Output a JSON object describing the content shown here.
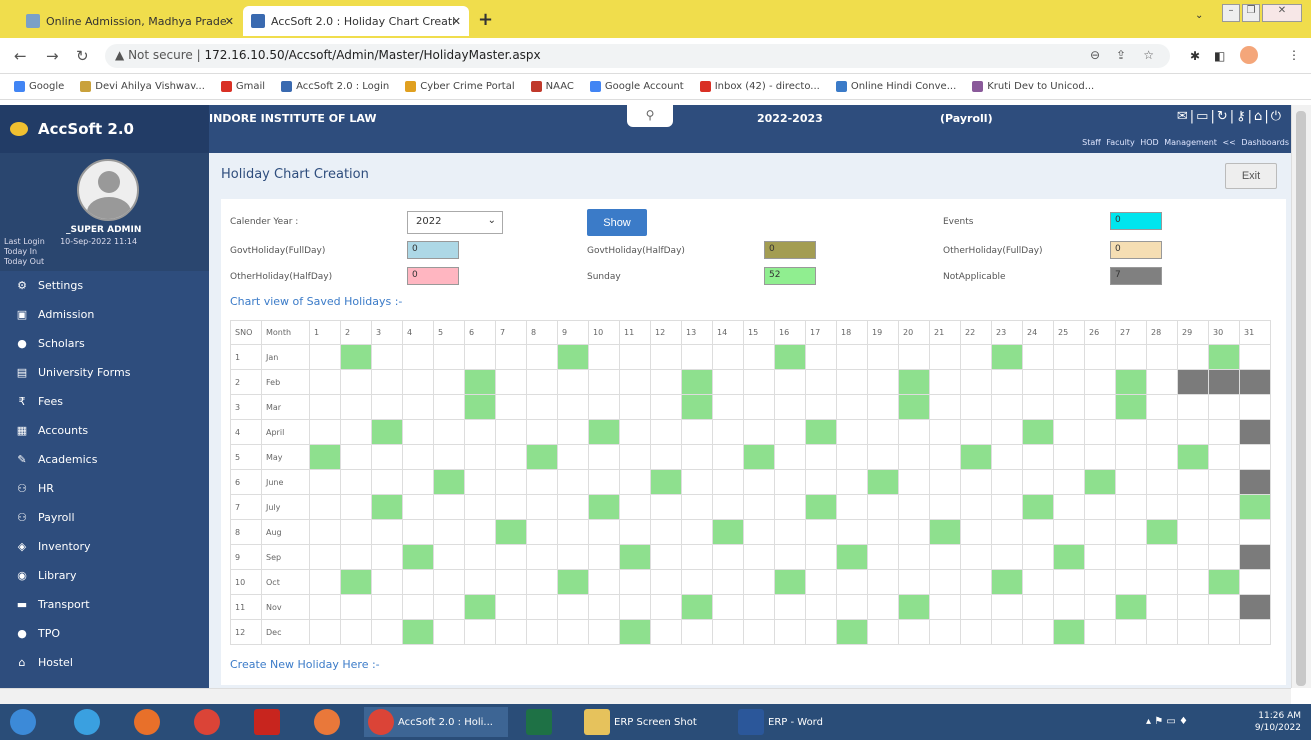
{
  "browser": {
    "tabs": [
      {
        "title": "Online Admission, Madhya Prade",
        "active": false
      },
      {
        "title": "AccSoft 2.0 : Holiday Chart Creati",
        "active": true
      }
    ],
    "new_tab": "+",
    "url_prefix": "Not secure",
    "url": "172.16.10.50/Accsoft/Admin/Master/HolidayMaster.aspx",
    "bookmarks": [
      "Google",
      "Devi Ahilya Vishwav...",
      "Gmail",
      "AccSoft 2.0 : Login",
      "Cyber Crime Portal",
      "NAAC",
      "Google Account",
      "Inbox (42) - directo...",
      "Online Hindi Conve...",
      "Kruti Dev to Unicod..."
    ]
  },
  "app": {
    "name": "AccSoft 2.0",
    "institute": "INDORE INSTITUTE OF LAW",
    "session": "2022-2023",
    "module": "(Payroll)",
    "top_links": "Staff Faculty HOD Management << Dashboards",
    "user": {
      "name": "_SUPER ADMIN",
      "last_login_label": "Last Login",
      "last_login": "10-Sep-2022 11:14",
      "today_in": "Today In",
      "today_out": "Today Out"
    },
    "menu": [
      "Settings",
      "Admission",
      "Scholars",
      "University Forms",
      "Fees",
      "Accounts",
      "Academics",
      "HR",
      "Payroll",
      "Inventory",
      "Library",
      "Transport",
      "TPO",
      "Hostel"
    ]
  },
  "page": {
    "title": "Holiday Chart Creation",
    "exit": "Exit",
    "calendar_year_label": "Calender Year :",
    "calendar_year": "2022",
    "show": "Show",
    "counters": {
      "events_label": "Events",
      "events": "0",
      "govt_full_label": "GovtHoliday(FullDay)",
      "govt_full": "0",
      "govt_half_label": "GovtHoliday(HalfDay)",
      "govt_half": "0",
      "other_full_label": "OtherHoliday(FullDay)",
      "other_full": "0",
      "other_half_label": "OtherHoliday(HalfDay)",
      "other_half": "0",
      "sunday_label": "Sunday",
      "sunday": "52",
      "na_label": "NotApplicable",
      "na": "7"
    },
    "colors": {
      "events": "#00e5ee",
      "govt_full": "#add8e6",
      "govt_half": "#a39d52",
      "other_full": "#f5deb3",
      "other_half": "#ffb6c1",
      "sunday": "#90ee90",
      "na": "#808080"
    },
    "chart_title": "Chart view of Saved Holidays :-",
    "create_title": "Create New Holiday Here :-",
    "grid_headers": [
      "SNO",
      "Month"
    ],
    "months": [
      "Jan",
      "Feb",
      "Mar",
      "April",
      "May",
      "June",
      "July",
      "Aug",
      "Sep",
      "Oct",
      "Nov",
      "Dec"
    ],
    "sundays": [
      [
        2,
        9,
        16,
        23,
        30
      ],
      [
        6,
        13,
        20,
        27
      ],
      [
        6,
        13,
        20,
        27
      ],
      [
        3,
        10,
        17,
        24
      ],
      [
        1,
        8,
        15,
        22,
        29
      ],
      [
        5,
        12,
        19,
        26
      ],
      [
        3,
        10,
        17,
        24,
        31
      ],
      [
        7,
        14,
        21,
        28
      ],
      [
        4,
        11,
        18,
        25
      ],
      [
        2,
        9,
        16,
        23,
        30
      ],
      [
        6,
        13,
        20,
        27
      ],
      [
        4,
        11,
        18,
        25
      ]
    ],
    "not_applicable": [
      [],
      [
        29,
        30,
        31
      ],
      [],
      [
        31
      ],
      [],
      [
        31
      ],
      [],
      [],
      [
        31
      ],
      [],
      [
        31
      ],
      []
    ]
  },
  "taskbar": {
    "items": [
      "AccSoft 2.0 : Holi...",
      "ERP Screen Shot",
      "ERP - Word"
    ],
    "time": "11:26 AM",
    "date": "9/10/2022"
  }
}
